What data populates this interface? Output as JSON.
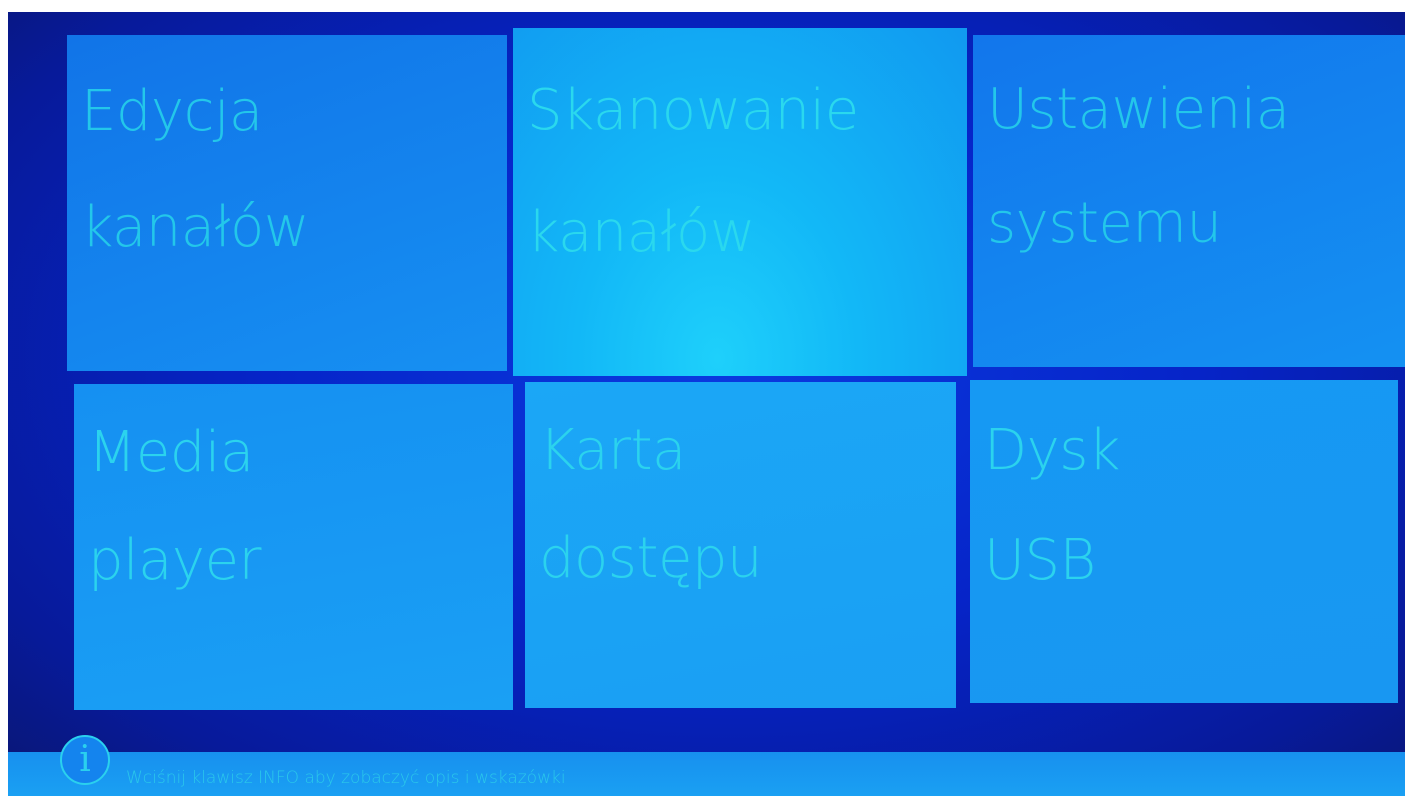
{
  "menu": {
    "tiles": [
      {
        "id": "edit",
        "line1": "Edycja",
        "line2": "kanałów"
      },
      {
        "id": "scan",
        "line1": "Skanowanie",
        "line2": "kanałów",
        "selected": true
      },
      {
        "id": "system",
        "line1": "Ustawienia",
        "line2": "systemu"
      },
      {
        "id": "media",
        "line1": "Media",
        "line2": "player"
      },
      {
        "id": "card",
        "line1": "Karta",
        "line2": "dostępu"
      },
      {
        "id": "usb",
        "line1": "Dysk",
        "line2": "USB"
      }
    ]
  },
  "footer": {
    "icon": "info-icon",
    "icon_glyph": "i",
    "hint": "Wciśnij klawisz INFO aby zobaczyć opis i wskazówki"
  },
  "colors": {
    "background": "#0624c8",
    "tile": "#1387ee",
    "tile_selected": "#1ed0fb",
    "text": "#2bd3ee"
  }
}
